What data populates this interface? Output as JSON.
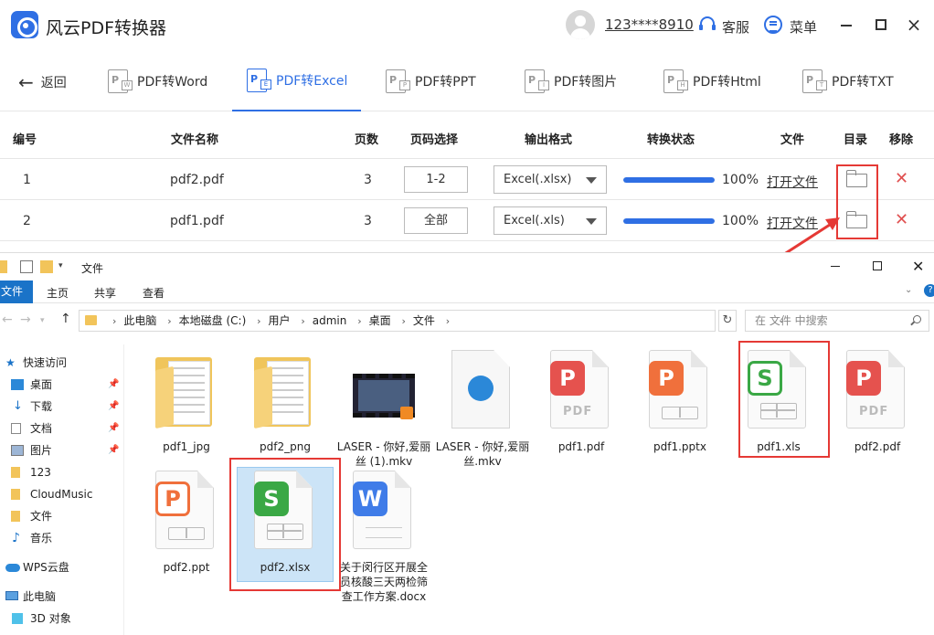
{
  "app": {
    "title": "风云PDF转换器",
    "user": "123****8910",
    "service": "客服",
    "menu": "菜单"
  },
  "tabs": {
    "back": "返回",
    "items": [
      {
        "label": "PDF转Word",
        "glyph": "P",
        "sub": "W",
        "active": false
      },
      {
        "label": "PDF转Excel",
        "glyph": "P",
        "sub": "E",
        "active": true
      },
      {
        "label": "PDF转PPT",
        "glyph": "P",
        "sub": "P",
        "active": false
      },
      {
        "label": "PDF转图片",
        "glyph": "P",
        "sub": "I",
        "active": false
      },
      {
        "label": "PDF转Html",
        "glyph": "P",
        "sub": "H",
        "active": false
      },
      {
        "label": "PDF转TXT",
        "glyph": "P",
        "sub": "T",
        "active": false
      }
    ]
  },
  "table": {
    "headers": {
      "num": "编号",
      "name": "文件名称",
      "pages": "页数",
      "range": "页码选择",
      "format": "输出格式",
      "status": "转换状态",
      "file": "文件",
      "dir": "目录",
      "remove": "移除"
    },
    "rows": [
      {
        "num": "1",
        "name": "pdf2.pdf",
        "pages": "3",
        "range": "1-2",
        "format": "Excel(.xlsx)",
        "progress": 100,
        "progress_label": "100%",
        "open": "打开文件"
      },
      {
        "num": "2",
        "name": "pdf1.pdf",
        "pages": "3",
        "range": "全部",
        "format": "Excel(.xls)",
        "progress": 100,
        "progress_label": "100%",
        "open": "打开文件"
      }
    ]
  },
  "explorer": {
    "title": "文件",
    "ribbon": {
      "file": "文件",
      "home": "主页",
      "share": "共享",
      "view": "查看"
    },
    "breadcrumbs": [
      "此电脑",
      "本地磁盘 (C:)",
      "用户",
      "admin",
      "桌面",
      "文件"
    ],
    "search_placeholder": "在 文件 中搜索",
    "nav": [
      {
        "label": "快速访问",
        "icon": "star",
        "pin": false
      },
      {
        "label": "桌面",
        "icon": "desktop",
        "pin": true
      },
      {
        "label": "下载",
        "icon": "download",
        "pin": true
      },
      {
        "label": "文档",
        "icon": "document",
        "pin": true
      },
      {
        "label": "图片",
        "icon": "picture",
        "pin": true
      },
      {
        "label": "123",
        "icon": "folder",
        "pin": false
      },
      {
        "label": "CloudMusic",
        "icon": "folder",
        "pin": false
      },
      {
        "label": "文件",
        "icon": "folder",
        "pin": false
      },
      {
        "label": "音乐",
        "icon": "music",
        "pin": false
      },
      {
        "label": "WPS云盘",
        "icon": "cloud",
        "pin": false
      },
      {
        "label": "此电脑",
        "icon": "computer",
        "pin": false
      },
      {
        "label": "3D 对象",
        "icon": "cube",
        "pin": false
      }
    ],
    "files": [
      {
        "name": "pdf1_jpg",
        "kind": "folder"
      },
      {
        "name": "pdf2_png",
        "kind": "folder"
      },
      {
        "name": "LASER - 你好,爱丽丝 (1).mkv",
        "kind": "video"
      },
      {
        "name": "LASER - 你好,爱丽丝.mkv",
        "kind": "media"
      },
      {
        "name": "pdf1.pdf",
        "kind": "pdf"
      },
      {
        "name": "pdf1.pptx",
        "kind": "ppt"
      },
      {
        "name": "pdf1.xls",
        "kind": "xls"
      },
      {
        "name": "pdf2.pdf",
        "kind": "pdf"
      },
      {
        "name": "pdf2.ppt",
        "kind": "ppt-outline"
      },
      {
        "name": "pdf2.xlsx",
        "kind": "xls"
      },
      {
        "name": "关于闵行区开展全员核酸三天两检筛查工作方案.docx",
        "kind": "doc"
      }
    ]
  },
  "colors": {
    "accent": "#2f6fe4",
    "highlight_red": "#e53935",
    "pdf_red": "#e5524e",
    "ppt_orange": "#f0703c",
    "xls_green": "#3aa845",
    "doc_blue": "#3f7ce8"
  }
}
